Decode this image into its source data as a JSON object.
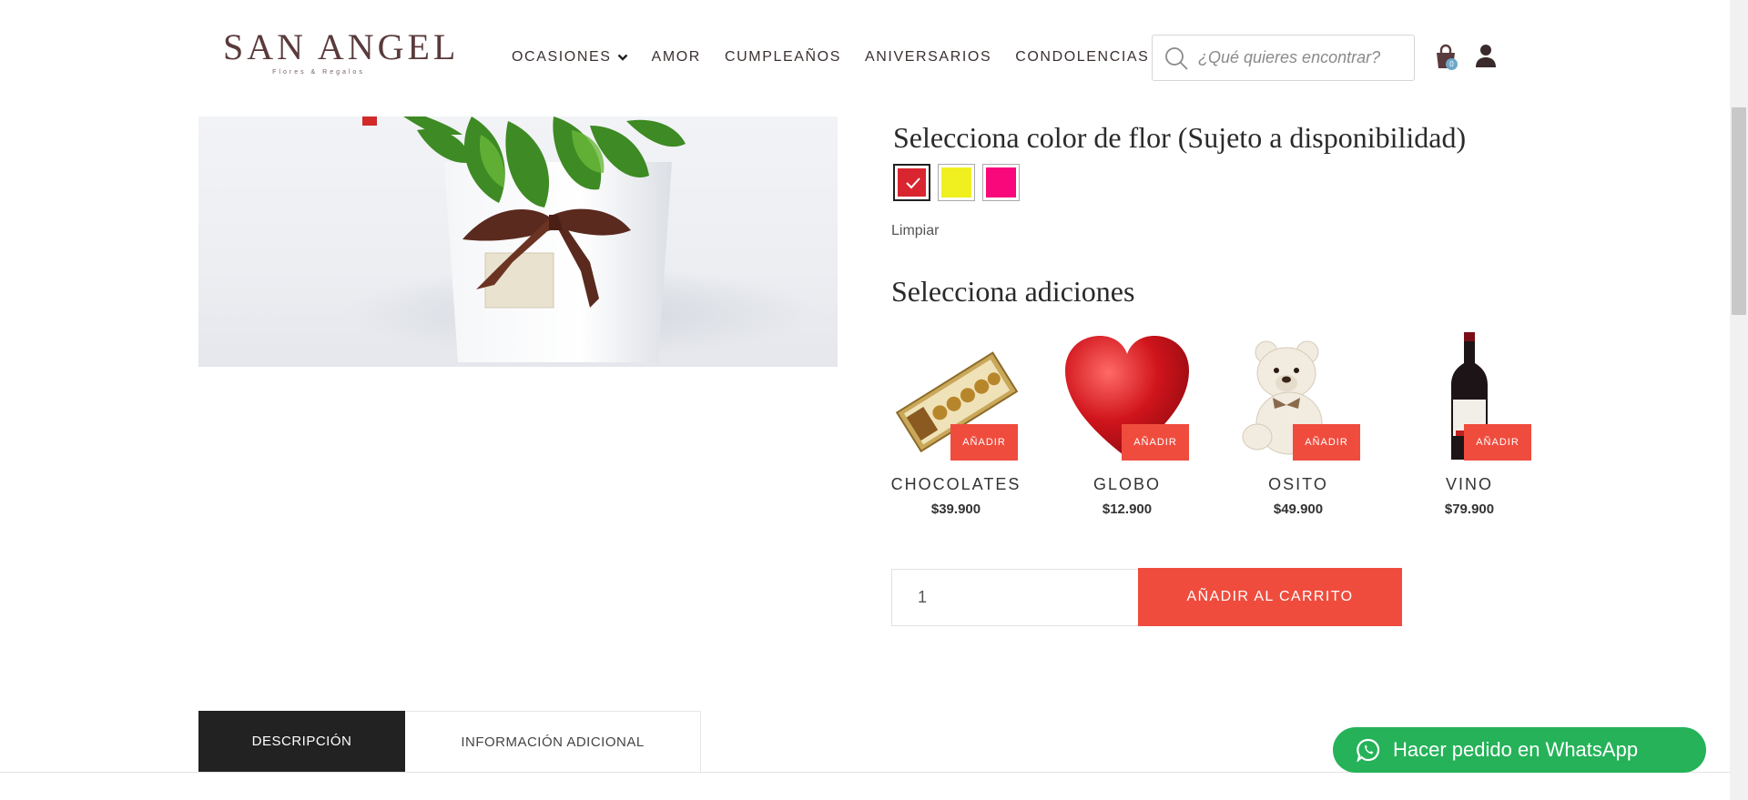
{
  "header": {
    "logo_main": "SAN ANGEL",
    "logo_sub": "Flores & Regalos",
    "nav": [
      {
        "label": "OCASIONES"
      },
      {
        "label": "AMOR"
      },
      {
        "label": "CUMPLEAÑOS"
      },
      {
        "label": "ANIVERSARIOS"
      },
      {
        "label": "CONDOLENCIAS"
      }
    ],
    "search_placeholder": "¿Qué quieres encontrar?",
    "cart_count": "0"
  },
  "product": {
    "color_title": "Selecciona color de flor (Sujeto a disponibilidad)",
    "colors": [
      {
        "name": "rojo",
        "hex": "#d9252f",
        "selected": true
      },
      {
        "name": "amarillo",
        "hex": "#f0f020",
        "selected": false
      },
      {
        "name": "fucsia",
        "hex": "#f8087a",
        "selected": false
      }
    ],
    "clear_label": "Limpiar",
    "additions_title": "Selecciona adiciones",
    "addons": [
      {
        "name": "CHOCOLATES",
        "price": "$39.900",
        "button": "AÑADIR"
      },
      {
        "name": "GLOBO",
        "price": "$12.900",
        "button": "AÑADIR"
      },
      {
        "name": "OSITO",
        "price": "$49.900",
        "button": "AÑADIR"
      },
      {
        "name": "VINO",
        "price": "$79.900",
        "button": "AÑADIR"
      }
    ],
    "quantity": "1",
    "add_to_cart": "AÑADIR AL CARRITO"
  },
  "tabs": [
    {
      "label": "DESCRIPCIÓN",
      "active": true
    },
    {
      "label": "INFORMACIÓN ADICIONAL",
      "active": false
    }
  ],
  "whatsapp": {
    "label": "Hacer pedido en WhatsApp"
  },
  "colors": {
    "accent": "#ef4c3e",
    "whatsapp": "#25b259",
    "brand": "#5a3a3c"
  }
}
